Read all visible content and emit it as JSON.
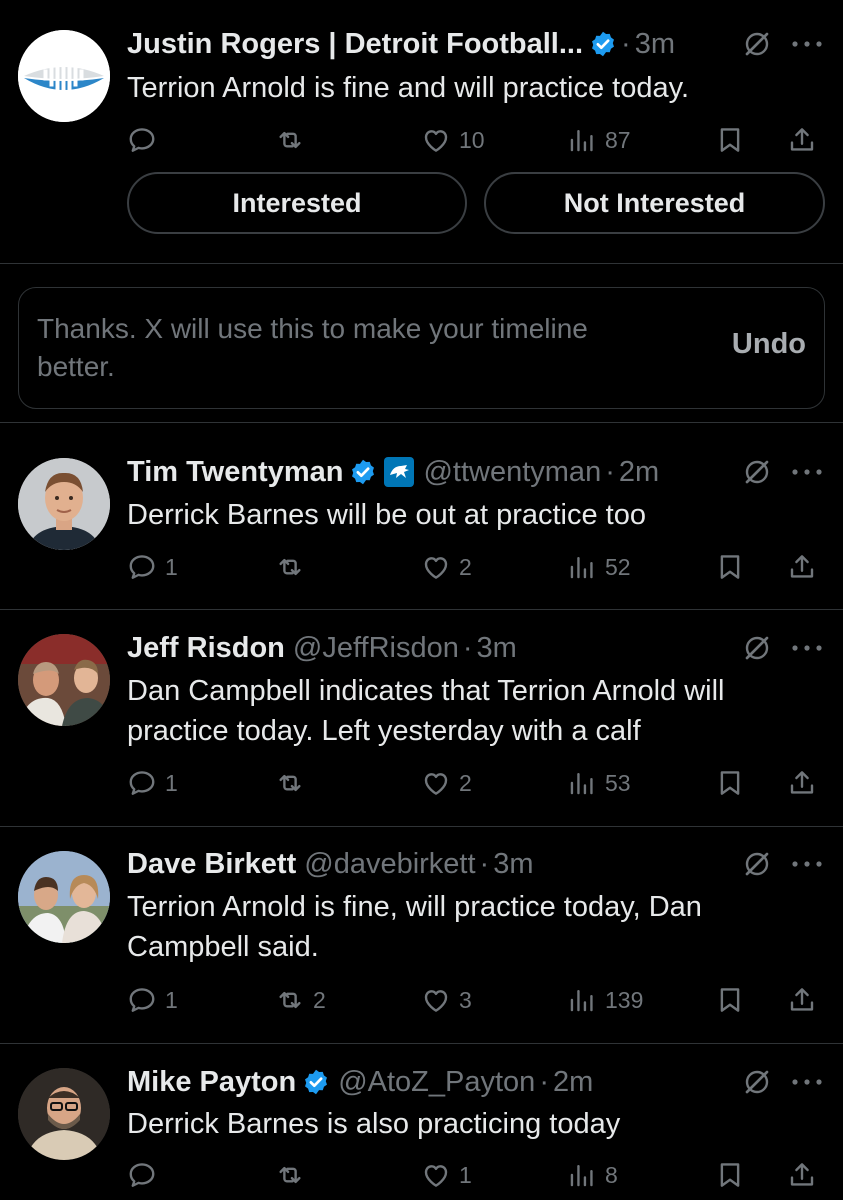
{
  "feed": {
    "posts": [
      {
        "name": "Justin Rogers | Detroit Football...",
        "handle": "",
        "verified": true,
        "dot": "·",
        "time": "3m",
        "text": "Terrion Arnold is fine and will practice today.",
        "replies": "",
        "reposts": "",
        "likes": "10",
        "views": "87",
        "avatar": "justin-rogers-logo-avatar",
        "options": [
          "Interested",
          "Not Interested"
        ]
      },
      {
        "name": "Tim Twentyman",
        "handle": "@ttwentyman",
        "verified": true,
        "dot": "·",
        "time": "2m",
        "text": "Derrick Barnes will be out at practice too",
        "replies": "1",
        "reposts": "",
        "likes": "2",
        "views": "52",
        "avatar": "tim-twentyman-avatar"
      },
      {
        "name": "Jeff Risdon",
        "handle": "@JeffRisdon",
        "verified": false,
        "dot": "·",
        "time": "3m",
        "text": "Dan Campbell indicates that Terrion Arnold will practice today. Left yesterday with a calf",
        "replies": "1",
        "reposts": "",
        "likes": "2",
        "views": "53",
        "avatar": "jeff-risdon-avatar"
      },
      {
        "name": "Dave Birkett",
        "handle": "@davebirkett",
        "verified": false,
        "dot": "·",
        "time": "3m",
        "text": "Terrion Arnold is fine, will practice today, Dan Campbell said.",
        "replies": "1",
        "reposts": "2",
        "likes": "3",
        "views": "139",
        "avatar": "dave-birkett-avatar"
      },
      {
        "name": "Mike Payton",
        "handle": "@AtoZ_Payton",
        "verified": true,
        "dot": "·",
        "time": "2m",
        "text": "Derrick Barnes is also practicing today",
        "replies": "",
        "reposts": "",
        "likes": "1",
        "views": "8",
        "avatar": "mike-payton-avatar"
      }
    ],
    "feedback": {
      "message": "Thanks. X will use this to make your timeline better.",
      "undo_label": "Undo"
    }
  },
  "colors": {
    "background": "#000000",
    "text": "#e7e9ea",
    "muted": "#71767b",
    "divider": "#2f3336",
    "verified_blue": "#1d9bf0"
  },
  "icons": [
    "reply-icon",
    "repost-icon",
    "like-icon",
    "views-icon",
    "bookmark-icon",
    "share-icon",
    "grok-icon",
    "more-icon",
    "verified-badge-icon",
    "team-affiliation-icon"
  ]
}
